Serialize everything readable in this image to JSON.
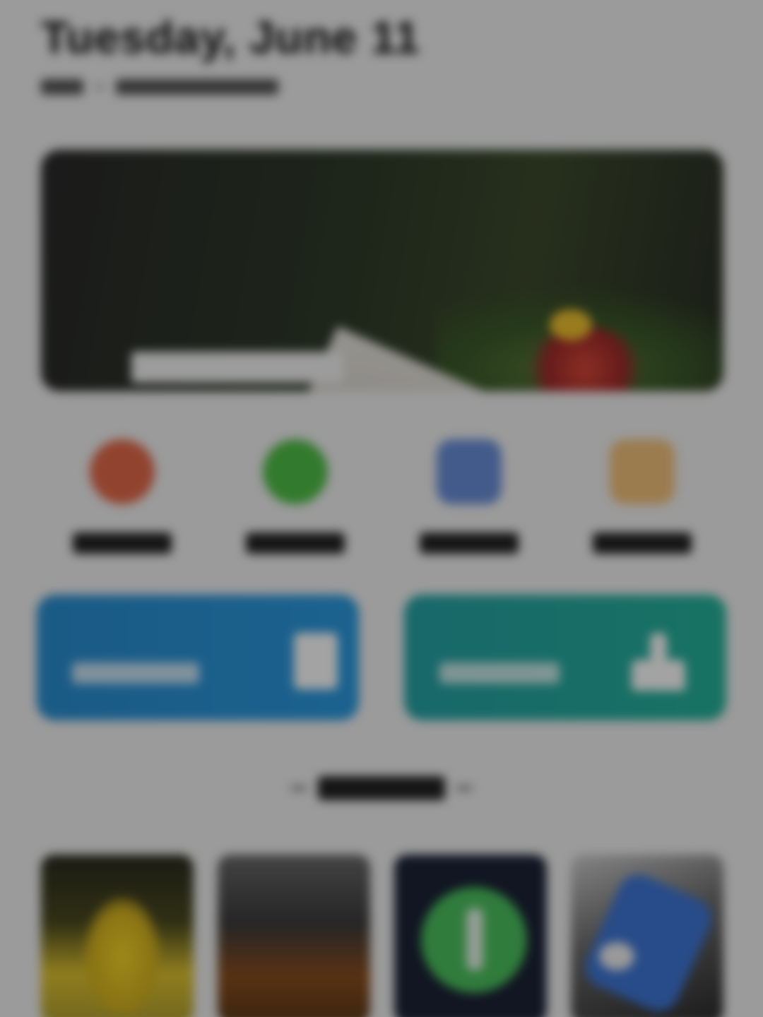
{
  "header": {
    "date_title": "Tuesday, June 11",
    "subline_left": "",
    "subline_right": ""
  },
  "banner": {
    "headline_line1": "",
    "headline_line2": "",
    "cta_label": ""
  },
  "quick_actions": [
    {
      "label": "",
      "icon": "orange-circle-icon",
      "color": "#e36a4a"
    },
    {
      "label": "",
      "icon": "green-circle-icon",
      "color": "#4fbf47"
    },
    {
      "label": "",
      "icon": "blue-square-icon",
      "color": "#6a8fd9"
    },
    {
      "label": "",
      "icon": "peach-square-icon",
      "color": "#f3c27c"
    }
  ],
  "cards": [
    {
      "label": "",
      "icon": "document-icon",
      "color": "#2a8ed1"
    },
    {
      "label": "",
      "icon": "hand-icon",
      "color": "#26b39b"
    }
  ],
  "section": {
    "title": ""
  },
  "thumbnails": [
    {
      "name": "thumbnail-1"
    },
    {
      "name": "thumbnail-2"
    },
    {
      "name": "thumbnail-3"
    },
    {
      "name": "thumbnail-4"
    }
  ],
  "overlay": {
    "color": "#000000"
  }
}
